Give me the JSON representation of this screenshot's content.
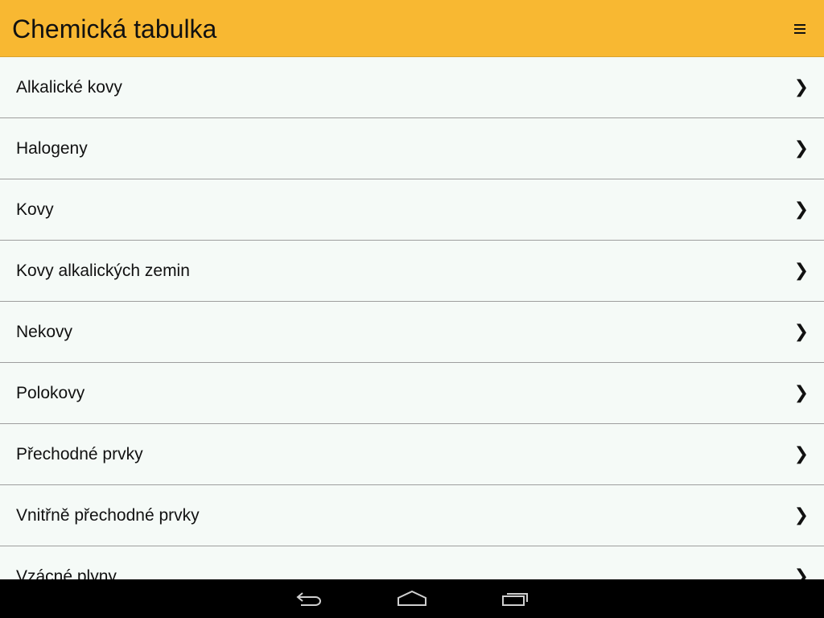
{
  "app_bar": {
    "title": "Chemická tabulka",
    "menu_icon": "hamburger-menu-icon",
    "background": "#f8b832"
  },
  "list": {
    "items": [
      {
        "label": "Alkalické kovy"
      },
      {
        "label": "Halogeny"
      },
      {
        "label": "Kovy"
      },
      {
        "label": "Kovy alkalických zemin"
      },
      {
        "label": "Nekovy"
      },
      {
        "label": "Polokovy"
      },
      {
        "label": "Přechodné prvky"
      },
      {
        "label": "Vnitřně přechodné prvky"
      },
      {
        "label": "Vzácné plyny"
      }
    ],
    "chevron": "❯"
  },
  "nav_bar": {
    "back_icon": "back-icon",
    "home_icon": "home-icon",
    "recents_icon": "recent-apps-icon"
  }
}
